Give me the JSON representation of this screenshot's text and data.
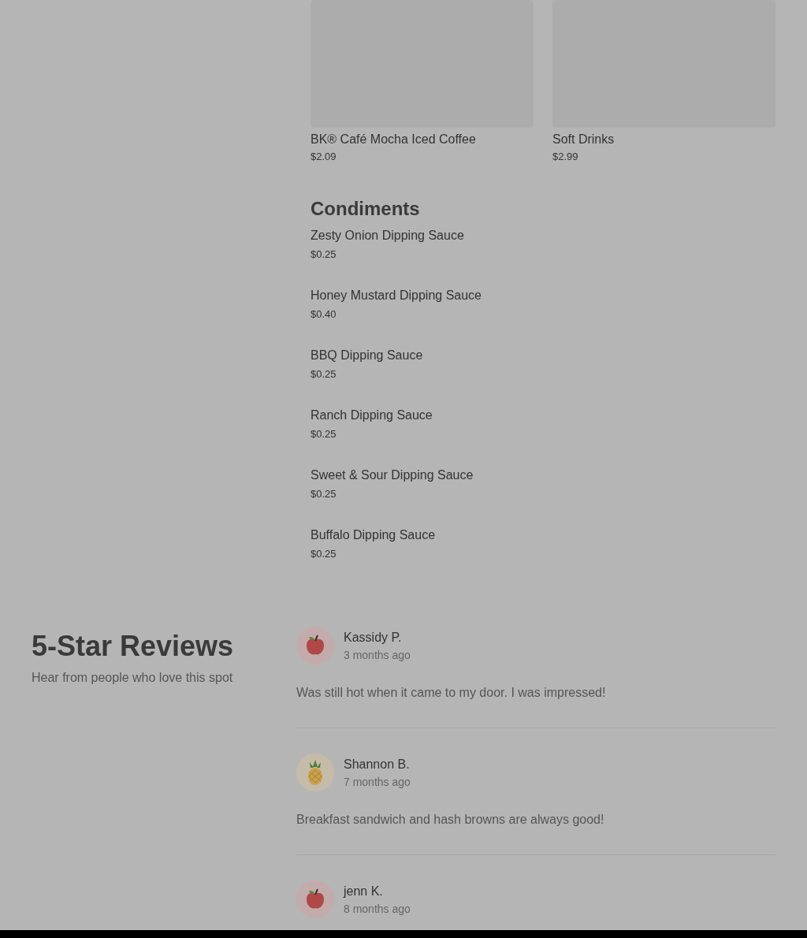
{
  "menu_items": [
    {
      "name": "BK® Café Mocha Iced Coffee",
      "price": "$2.09"
    },
    {
      "name": "Soft Drinks",
      "price": "$2.99"
    }
  ],
  "condiments": {
    "title": "Condiments",
    "items": [
      {
        "name": "Zesty Onion Dipping Sauce",
        "price": "$0.25"
      },
      {
        "name": "Honey Mustard Dipping Sauce",
        "price": "$0.40"
      },
      {
        "name": "BBQ Dipping Sauce",
        "price": "$0.25"
      },
      {
        "name": "Ranch Dipping Sauce",
        "price": "$0.25"
      },
      {
        "name": "Sweet & Sour Dipping Sauce",
        "price": "$0.25"
      },
      {
        "name": "Buffalo Dipping Sauce",
        "price": "$0.25"
      }
    ]
  },
  "reviews": {
    "title": "5-Star Reviews",
    "subtitle": "Hear from people who love this spot",
    "items": [
      {
        "avatar": {
          "kind": "apple"
        },
        "name": "Kassidy P.",
        "time": "3 months ago",
        "text": "Was still hot when it came to my door. I was impressed!"
      },
      {
        "avatar": {
          "kind": "pineapple"
        },
        "name": "Shannon B.",
        "time": "7 months ago",
        "text": "Breakfast sandwich and hash browns are always good!"
      },
      {
        "avatar": {
          "kind": "apple"
        },
        "name": "jenn K.",
        "time": "8 months ago"
      }
    ]
  }
}
